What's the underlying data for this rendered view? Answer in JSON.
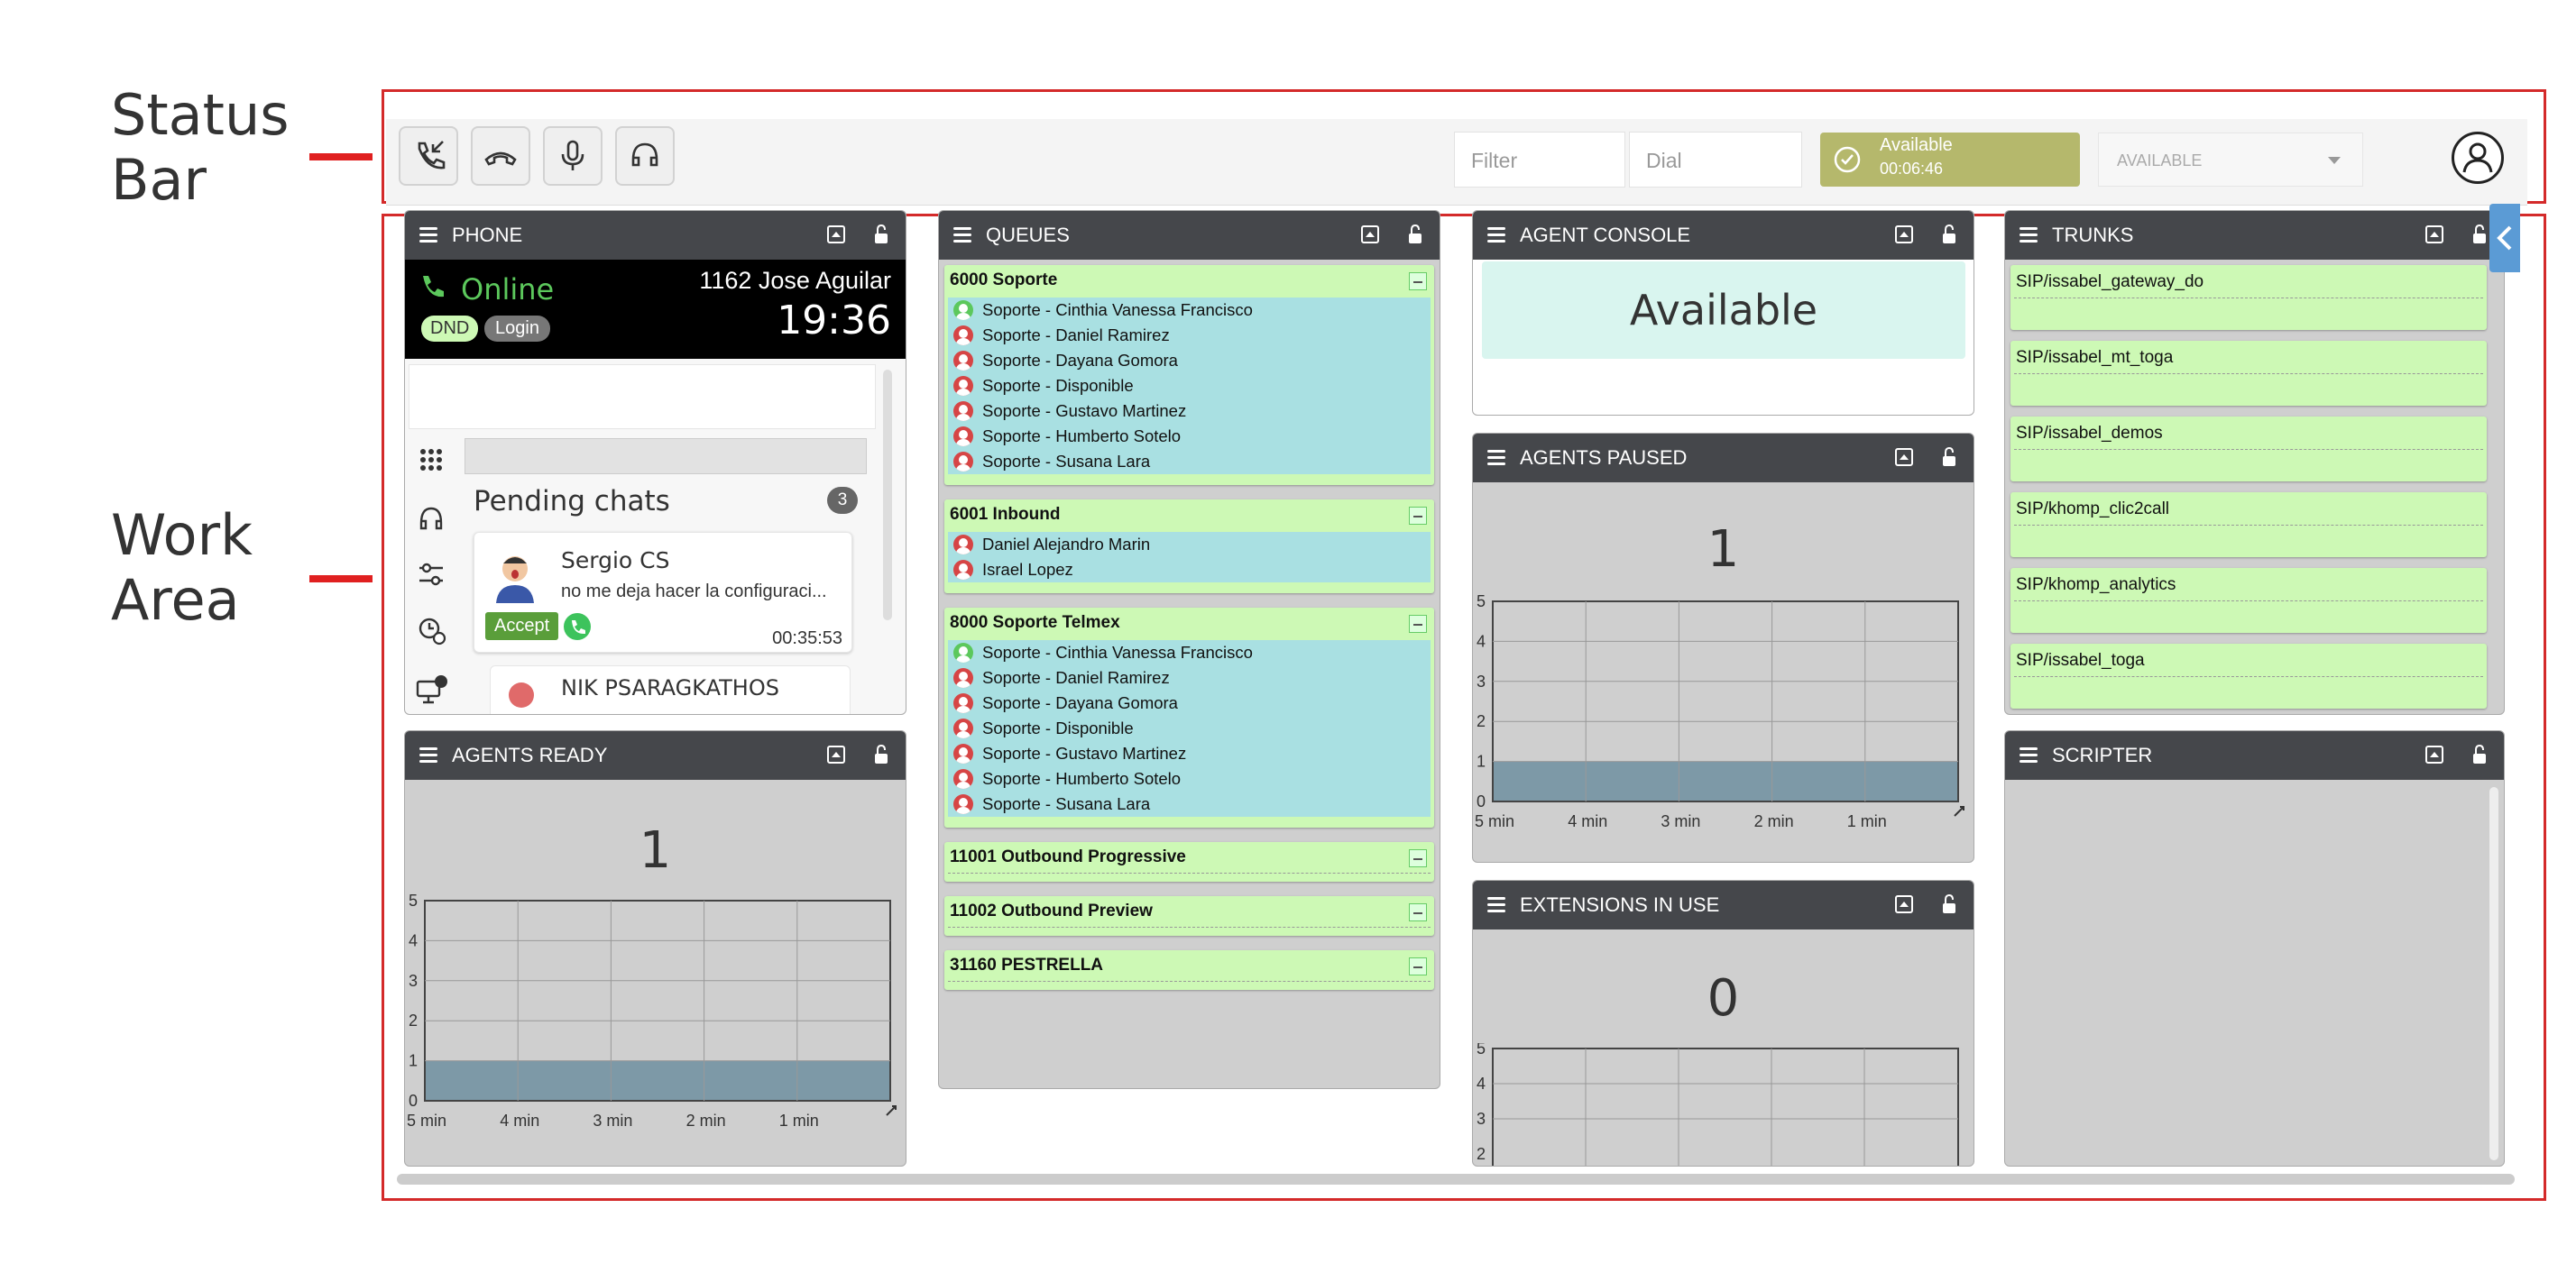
{
  "labels": {
    "status_bar": [
      "Status",
      "Bar"
    ],
    "work_area": [
      "Work",
      "Area"
    ]
  },
  "toolbar": {
    "filter_placeholder": "Filter",
    "dial_placeholder": "Dial",
    "status_label": "Available",
    "status_timer": "00:06:46",
    "state_select": "AVAILABLE"
  },
  "phone": {
    "title": "PHONE",
    "status": "Online",
    "agent": "1162 Jose Aguilar",
    "clock": "19:36",
    "dnd": "DND",
    "login": "Login",
    "pending_title": "Pending chats",
    "pending_count": "3",
    "chats": [
      {
        "name": "Sergio CS",
        "message": "no me deja hacer la configuraci...",
        "accept": "Accept",
        "time": "00:35:53"
      },
      {
        "name": "NIK PSARAGKATHOS"
      }
    ]
  },
  "queues": {
    "title": "QUEUES",
    "items": [
      {
        "name": "6000 Soporte",
        "members": [
          "Soporte - Cinthia Vanessa Francisco",
          "Soporte - Daniel Ramirez",
          "Soporte - Dayana Gomora",
          "Soporte - Disponible",
          "Soporte - Gustavo Martinez",
          "Soporte - Humberto Sotelo",
          "Soporte - Susana Lara"
        ]
      },
      {
        "name": "6001 Inbound",
        "members": [
          "Daniel Alejandro Marin",
          "Israel Lopez"
        ]
      },
      {
        "name": "8000 Soporte Telmex",
        "members": [
          "Soporte - Cinthia Vanessa Francisco",
          "Soporte - Daniel Ramirez",
          "Soporte - Dayana Gomora",
          "Soporte - Disponible",
          "Soporte - Gustavo Martinez",
          "Soporte - Humberto Sotelo",
          "Soporte - Susana Lara"
        ]
      },
      {
        "name": "11001 Outbound Progressive",
        "members": []
      },
      {
        "name": "11002 Outbound Preview",
        "members": []
      },
      {
        "name": "31160 PESTRELLA",
        "members": []
      }
    ]
  },
  "agent_console": {
    "title": "AGENT CONSOLE",
    "status": "Available"
  },
  "agents_paused": {
    "title": "AGENTS PAUSED",
    "count": "1"
  },
  "agents_ready": {
    "title": "AGENTS READY",
    "count": "1"
  },
  "extensions": {
    "title": "EXTENSIONS IN USE",
    "count": "0"
  },
  "trunks": {
    "title": "TRUNKS",
    "items": [
      "SIP/issabel_gateway_do",
      "SIP/issabel_mt_toga",
      "SIP/issabel_demos",
      "SIP/khomp_clic2call",
      "SIP/khomp_analytics",
      "SIP/issabel_toga"
    ]
  },
  "scripter": {
    "title": "SCRIPTER"
  },
  "chart_data": [
    {
      "type": "area",
      "x": [
        "5 min",
        "4 min",
        "3 min",
        "2 min",
        "1 min"
      ],
      "values": [
        1,
        1,
        1,
        1,
        1
      ],
      "ylim": [
        0,
        5
      ],
      "yticks": [
        "0",
        "1",
        "2",
        "3",
        "4",
        "5"
      ],
      "grid": true
    },
    {
      "type": "area",
      "x": [
        "5 min",
        "4 min",
        "3 min",
        "2 min",
        "1 min"
      ],
      "values": [
        1,
        1,
        1,
        1,
        1
      ],
      "ylim": [
        0,
        5
      ],
      "yticks": [
        "0",
        "1",
        "2",
        "3",
        "4",
        "5"
      ],
      "grid": true
    }
  ],
  "colors": {
    "online": "#5cc85c",
    "queue_bg": "#cdf9b5",
    "member_bg": "#a9e0e2",
    "status_pill": "#b5b86c",
    "frame": "#d42a2a",
    "chart_fill": "#6e8fa0"
  }
}
